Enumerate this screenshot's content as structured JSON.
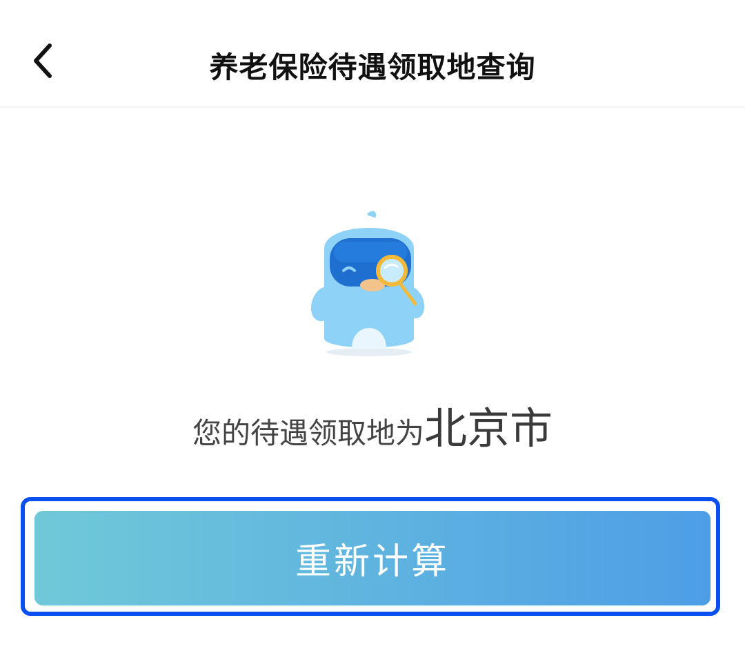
{
  "header": {
    "title": "养老保险待遇领取地查询",
    "back_icon": "chevron-left-icon"
  },
  "illustration": {
    "name": "mascot-with-magnifier",
    "colors": {
      "body": "#8fd2f7",
      "face": "#1f6fd1",
      "beak": "#f2c38a",
      "magnifier": "#f2b93b"
    }
  },
  "result": {
    "prefix": "您的待遇领取地为",
    "city": "北京市"
  },
  "actions": {
    "recalculate_label": "重新计算"
  },
  "colors": {
    "highlight_border": "#0a50f0",
    "button_gradient_start": "#6fc9d8",
    "button_gradient_end": "#4d9ee6"
  }
}
